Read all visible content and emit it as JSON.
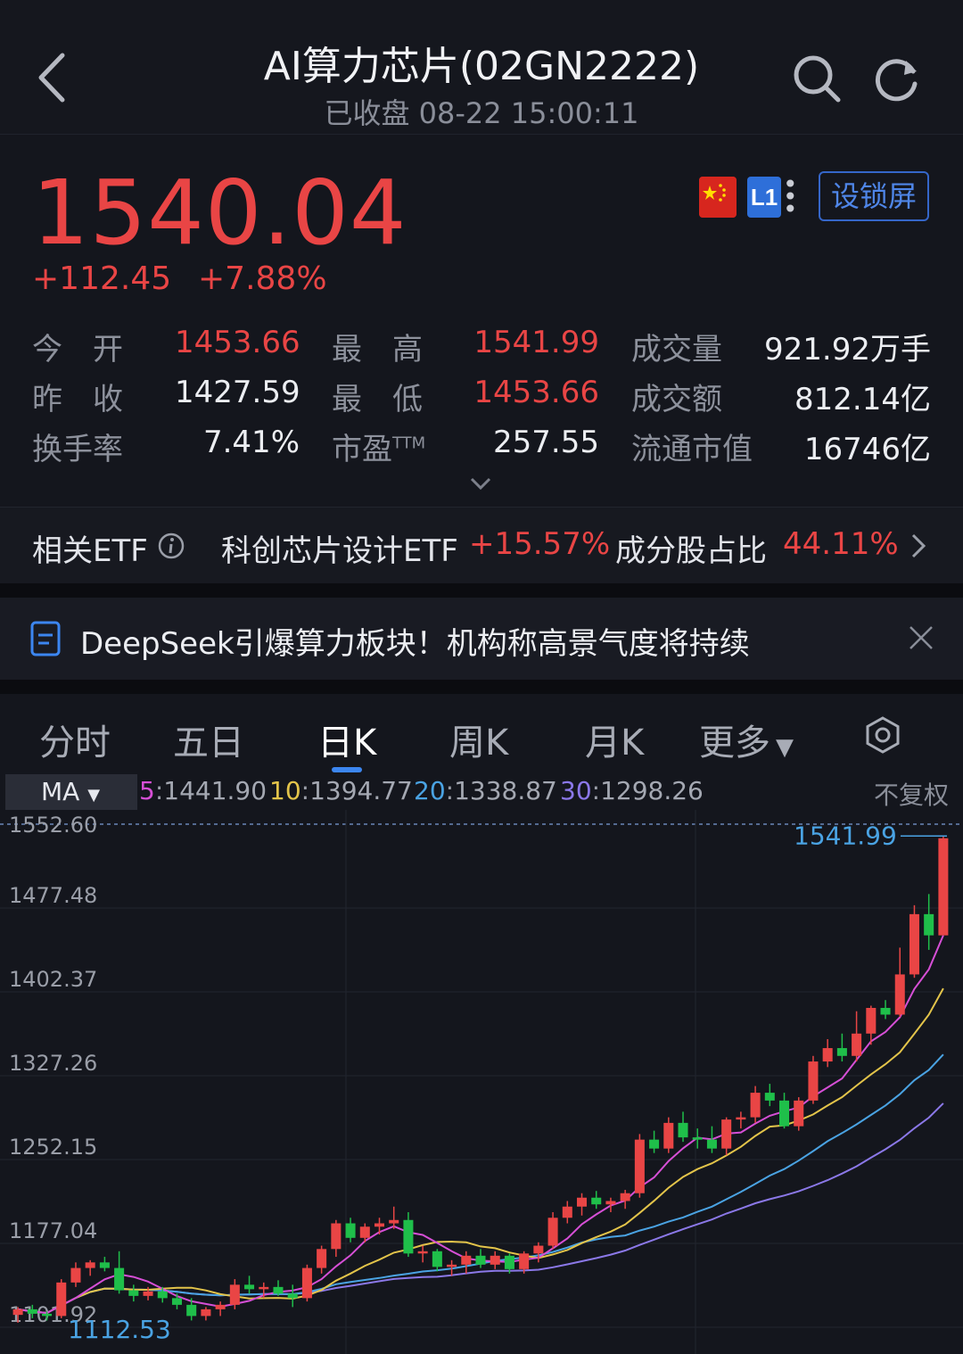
{
  "header": {
    "title": "AI算力芯片(02GN2222)",
    "status": "已收盘 08-22 15:00:11"
  },
  "quote": {
    "price": "1540.04",
    "change": "+112.45",
    "change_pct": "+7.88%",
    "level_badge": "L1",
    "lock_button": "设锁屏",
    "colors": {
      "up": "#e94545",
      "down": "#1fbf4a",
      "accent": "#3c86f0"
    }
  },
  "stats": [
    {
      "label": "今　开",
      "value": "1453.66",
      "tone": "red"
    },
    {
      "label": "最　高",
      "value": "1541.99",
      "tone": "red"
    },
    {
      "label": "成交量",
      "value": "921.92万手",
      "tone": "white"
    },
    {
      "label": "昨　收",
      "value": "1427.59",
      "tone": "white"
    },
    {
      "label": "最　低",
      "value": "1453.66",
      "tone": "red"
    },
    {
      "label": "成交额",
      "value": "812.14亿",
      "tone": "white"
    },
    {
      "label": "换手率",
      "value": "7.41%",
      "tone": "white"
    },
    {
      "label": "市盈",
      "label_sup": "TTM",
      "value": "257.55",
      "tone": "white"
    },
    {
      "label": "流通市值",
      "value": "16746亿",
      "tone": "white"
    }
  ],
  "etf": {
    "label": "相关ETF",
    "name": "科创芯片设计ETF",
    "change": "+15.57%",
    "share_label": "成分股占比",
    "share_value": "44.11%"
  },
  "news": {
    "headline": "DeepSeek引爆算力板块！机构称高景气度将持续"
  },
  "tabs": [
    "分时",
    "五日",
    "日K",
    "周K",
    "月K",
    "更多"
  ],
  "active_tab": "日K",
  "indicator": {
    "selector": "MA",
    "items": [
      {
        "period": "5",
        "value": "1441.90",
        "color": "#d64fd6"
      },
      {
        "period": "10",
        "value": "1394.77",
        "color": "#e3c44a"
      },
      {
        "period": "20",
        "value": "1338.87",
        "color": "#4aa3e3"
      },
      {
        "period": "30",
        "value": "1298.26",
        "color": "#8b78e8"
      }
    ],
    "adjust": "不复权"
  },
  "chart_data": {
    "type": "candlestick",
    "y_ticks": [
      "1552.60",
      "1477.48",
      "1402.37",
      "1327.26",
      "1252.15",
      "1177.04",
      "1101.92"
    ],
    "ylim": [
      1101.92,
      1552.6
    ],
    "max_label": "1541.99",
    "min_label": "1112.53",
    "candles": [
      [
        1113,
        1120,
        1106,
        1118
      ],
      [
        1118,
        1122,
        1110,
        1114
      ],
      [
        1114,
        1116,
        1108,
        1112
      ],
      [
        1112,
        1145,
        1110,
        1142
      ],
      [
        1142,
        1160,
        1138,
        1155
      ],
      [
        1155,
        1162,
        1148,
        1160
      ],
      [
        1160,
        1165,
        1152,
        1155
      ],
      [
        1155,
        1170,
        1132,
        1135
      ],
      [
        1135,
        1140,
        1125,
        1130
      ],
      [
        1130,
        1138,
        1126,
        1134
      ],
      [
        1134,
        1138,
        1124,
        1128
      ],
      [
        1128,
        1132,
        1118,
        1122
      ],
      [
        1122,
        1128,
        1108,
        1112
      ],
      [
        1112,
        1120,
        1108,
        1118
      ],
      [
        1118,
        1125,
        1112,
        1122
      ],
      [
        1122,
        1145,
        1118,
        1140
      ],
      [
        1140,
        1148,
        1132,
        1136
      ],
      [
        1136,
        1142,
        1128,
        1138
      ],
      [
        1138,
        1144,
        1130,
        1132
      ],
      [
        1132,
        1140,
        1120,
        1128
      ],
      [
        1128,
        1158,
        1125,
        1155
      ],
      [
        1155,
        1175,
        1150,
        1172
      ],
      [
        1172,
        1198,
        1165,
        1195
      ],
      [
        1195,
        1200,
        1178,
        1182
      ],
      [
        1182,
        1195,
        1178,
        1192
      ],
      [
        1192,
        1200,
        1185,
        1195
      ],
      [
        1195,
        1210,
        1190,
        1198
      ],
      [
        1198,
        1205,
        1165,
        1168
      ],
      [
        1168,
        1175,
        1160,
        1170
      ],
      [
        1170,
        1172,
        1152,
        1156
      ],
      [
        1156,
        1162,
        1148,
        1158
      ],
      [
        1158,
        1170,
        1150,
        1166
      ],
      [
        1166,
        1172,
        1155,
        1158
      ],
      [
        1158,
        1170,
        1154,
        1166
      ],
      [
        1166,
        1168,
        1150,
        1154
      ],
      [
        1154,
        1170,
        1150,
        1168
      ],
      [
        1168,
        1178,
        1160,
        1175
      ],
      [
        1175,
        1205,
        1172,
        1200
      ],
      [
        1200,
        1215,
        1195,
        1210
      ],
      [
        1210,
        1222,
        1202,
        1218
      ],
      [
        1218,
        1224,
        1208,
        1212
      ],
      [
        1212,
        1218,
        1205,
        1215
      ],
      [
        1215,
        1225,
        1208,
        1222
      ],
      [
        1222,
        1275,
        1218,
        1270
      ],
      [
        1270,
        1278,
        1258,
        1262
      ],
      [
        1262,
        1290,
        1258,
        1285
      ],
      [
        1285,
        1295,
        1268,
        1272
      ],
      [
        1272,
        1280,
        1262,
        1270
      ],
      [
        1270,
        1282,
        1258,
        1262
      ],
      [
        1262,
        1290,
        1256,
        1288
      ],
      [
        1288,
        1295,
        1280,
        1290
      ],
      [
        1290,
        1318,
        1285,
        1312
      ],
      [
        1312,
        1320,
        1300,
        1305
      ],
      [
        1305,
        1312,
        1280,
        1282
      ],
      [
        1282,
        1308,
        1278,
        1305
      ],
      [
        1305,
        1345,
        1302,
        1340
      ],
      [
        1340,
        1360,
        1335,
        1352
      ],
      [
        1352,
        1365,
        1340,
        1345
      ],
      [
        1345,
        1385,
        1340,
        1365
      ],
      [
        1365,
        1390,
        1355,
        1388
      ],
      [
        1388,
        1395,
        1378,
        1382
      ],
      [
        1382,
        1442,
        1380,
        1418
      ],
      [
        1418,
        1480,
        1415,
        1472
      ],
      [
        1472,
        1490,
        1440,
        1453
      ],
      [
        1453,
        1542,
        1453,
        1540
      ]
    ],
    "ma_last": {
      "MA5": 1441.9,
      "MA10": 1394.77,
      "MA20": 1338.87,
      "MA30": 1298.26
    }
  }
}
